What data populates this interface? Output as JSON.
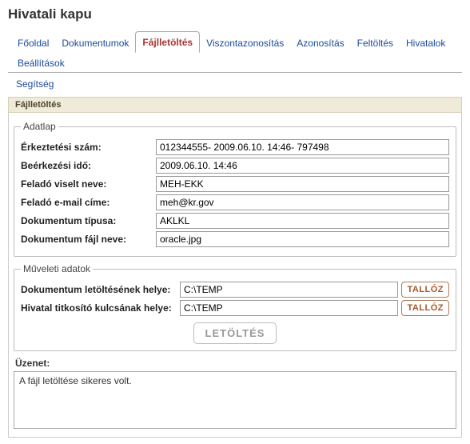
{
  "title": "Hivatali kapu",
  "tabs": {
    "row1": [
      "Főoldal",
      "Dokumentumok",
      "Fájlletöltés",
      "Viszontazonosítás",
      "Azonosítás",
      "Feltöltés",
      "Hivatalok",
      "Beállítások"
    ],
    "row2": [
      "Segítség"
    ],
    "active": "Fájlletöltés"
  },
  "sectionTitle": "Fájlletöltés",
  "adatlap": {
    "legend": "Adatlap",
    "fields": [
      {
        "label": "Érkeztetési szám:",
        "value": "012344555- 2009.06.10. 14:46- 797498"
      },
      {
        "label": "Beérkezési idő:",
        "value": "2009.06.10. 14:46"
      },
      {
        "label": "Feladó viselt neve:",
        "value": "MEH-EKK"
      },
      {
        "label": "Feladó e-mail címe:",
        "value": "meh@kr.gov"
      },
      {
        "label": "Dokumentum típusa:",
        "value": "AKLKL"
      },
      {
        "label": "Dokumentum fájl neve:",
        "value": "oracle.jpg"
      }
    ]
  },
  "muveleti": {
    "legend": "Műveleti adatok",
    "fields": [
      {
        "label": "Dokumentum letöltésének helye:",
        "value": "C:\\TEMP",
        "btn": "TALLÓZ"
      },
      {
        "label": "Hivatal titkosító kulcsának helye:",
        "value": "C:\\TEMP",
        "btn": "TALLÓZ"
      }
    ],
    "downloadBtn": "LETÖLTÉS"
  },
  "message": {
    "label": "Üzenet:",
    "text": "A fájl letöltése sikeres volt."
  }
}
